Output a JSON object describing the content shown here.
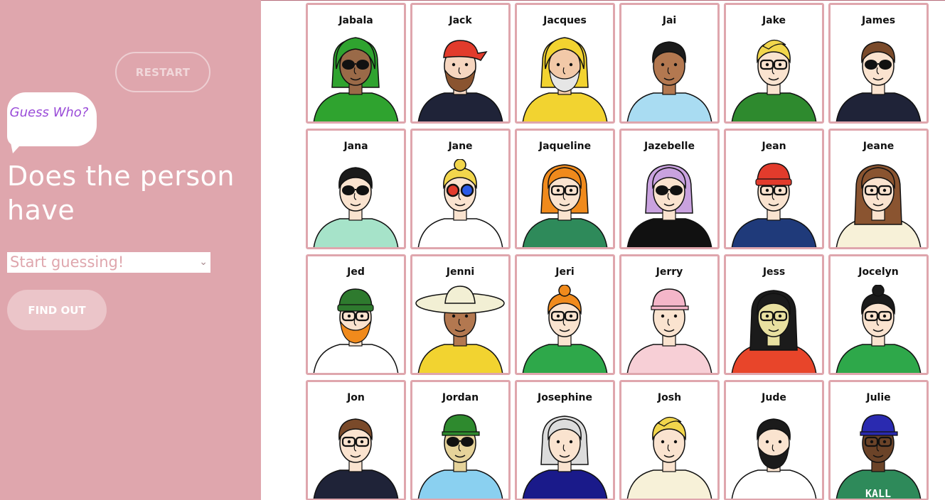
{
  "sidebar": {
    "restart_label": "RESTART",
    "logo_text": "Guess Who?",
    "question": "Does the person have",
    "select_value": "Start guessing!",
    "find_out_label": "FIND OUT"
  },
  "characters": [
    {
      "name": "Jabala",
      "skin": "#9a6a48",
      "hair": "#2fa32f",
      "top": "#2fa32f",
      "hair_style": "hijab",
      "glasses": "sun"
    },
    {
      "name": "Jack",
      "skin": "#f6d6c0",
      "hair": "#e23b2c",
      "top": "#1f2338",
      "hair_style": "bandana",
      "glasses": "none",
      "beard": "#8a5430"
    },
    {
      "name": "Jacques",
      "skin": "#f2c9a8",
      "hair": "#f2d330",
      "top": "#f2d330",
      "hair_style": "hood",
      "glasses": "none",
      "beard": "#e6e6e6"
    },
    {
      "name": "Jai",
      "skin": "#b37850",
      "hair": "#1b1b1b",
      "top": "#a9dcf2",
      "hair_style": "short",
      "glasses": "none"
    },
    {
      "name": "Jake",
      "skin": "#fae3cf",
      "hair": "#f2d64c",
      "top": "#2e8a2e",
      "hair_style": "quiff",
      "glasses": "clear"
    },
    {
      "name": "James",
      "skin": "#fae3cf",
      "hair": "#7a4a2a",
      "top": "#1f2338",
      "hair_style": "short",
      "glasses": "sun"
    },
    {
      "name": "Jana",
      "skin": "#fae3cf",
      "hair": "#1b1b1b",
      "top": "#a6e3c9",
      "hair_style": "short",
      "glasses": "sun"
    },
    {
      "name": "Jane",
      "skin": "#fae3cf",
      "hair": "#f2d64c",
      "top": "#ffffff",
      "hair_style": "bun",
      "glasses": "3d"
    },
    {
      "name": "Jaqueline",
      "skin": "#fae3cf",
      "hair": "#f08a1c",
      "top": "#2e8a5a",
      "hair_style": "bob",
      "glasses": "clear"
    },
    {
      "name": "Jazebelle",
      "skin": "#fae3cf",
      "hair": "#c9a2df",
      "top": "#111111",
      "hair_style": "bob",
      "glasses": "sun"
    },
    {
      "name": "Jean",
      "skin": "#fae3cf",
      "hair": "#e23b2c",
      "top": "#1f3a7a",
      "hair_style": "beanie",
      "glasses": "clear"
    },
    {
      "name": "Jeane",
      "skin": "#fae3cf",
      "hair": "#8a5430",
      "top": "#f7f1d8",
      "hair_style": "long",
      "glasses": "clear"
    },
    {
      "name": "Jed",
      "skin": "#fae3cf",
      "hair": "#2e7a2e",
      "top": "#ffffff",
      "hair_style": "beanie",
      "glasses": "clear",
      "beard": "#f08a1c"
    },
    {
      "name": "Jenni",
      "skin": "#b37850",
      "hair": "#f2efd4",
      "top": "#f2d330",
      "hair_style": "hat",
      "glasses": "none"
    },
    {
      "name": "Jeri",
      "skin": "#fae3cf",
      "hair": "#f08a1c",
      "top": "#2ea84a",
      "hair_style": "bun",
      "glasses": "clear"
    },
    {
      "name": "Jerry",
      "skin": "#fae3cf",
      "hair": "#f4b6c9",
      "top": "#f7cfd6",
      "hair_style": "cap",
      "glasses": "none"
    },
    {
      "name": "Jess",
      "skin": "#e8e0a0",
      "hair": "#1b1b1b",
      "top": "#e8452a",
      "hair_style": "long",
      "glasses": "clear"
    },
    {
      "name": "Jocelyn",
      "skin": "#fae3cf",
      "hair": "#1b1b1b",
      "top": "#2ea84a",
      "hair_style": "bun",
      "glasses": "clear"
    },
    {
      "name": "Jon",
      "skin": "#fae3cf",
      "hair": "#7a4a2a",
      "top": "#1f2338",
      "hair_style": "short",
      "glasses": "clear"
    },
    {
      "name": "Jordan",
      "skin": "#e6d39a",
      "hair": "#2e8a2e",
      "top": "#8ad0f0",
      "hair_style": "cap",
      "glasses": "sun"
    },
    {
      "name": "Josephine",
      "skin": "#fae3cf",
      "hair": "#dcdcdc",
      "top": "#1a1a8a",
      "hair_style": "bob",
      "glasses": "none"
    },
    {
      "name": "Josh",
      "skin": "#fae3cf",
      "hair": "#f2d64c",
      "top": "#f7f1d8",
      "hair_style": "quiff",
      "glasses": "none"
    },
    {
      "name": "Jude",
      "skin": "#fae3cf",
      "hair": "#1b1b1b",
      "top": "#ffffff",
      "hair_style": "short",
      "glasses": "none",
      "beard": "#1b1b1b"
    },
    {
      "name": "Julie",
      "skin": "#6b4328",
      "hair": "#2a2ab0",
      "top": "#2e8a5a",
      "hair_style": "cap",
      "glasses": "clear",
      "shirt_text": "KALL"
    }
  ]
}
